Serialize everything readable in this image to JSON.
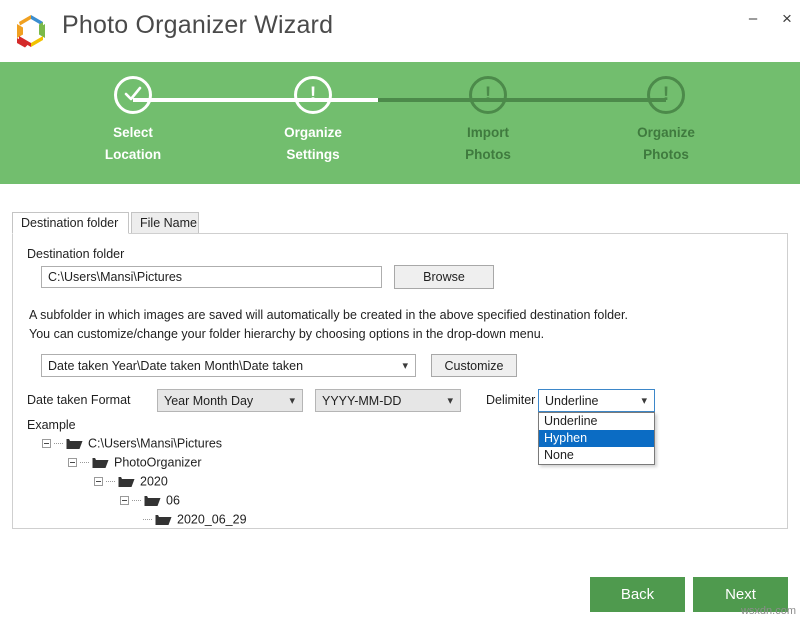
{
  "window": {
    "title": "Photo Organizer Wizard",
    "logo_icon": "hexagon-pinwheel-logo",
    "minimize_label": "–",
    "close_label": "×"
  },
  "stepper": {
    "accent_color": "#72be6e",
    "inactive_color": "#4c8a4a",
    "steps": [
      {
        "line1": "Select",
        "line2": "Location",
        "glyph": "✓",
        "state": "done",
        "icon": "check-icon"
      },
      {
        "line1": "Organize",
        "line2": "Settings",
        "glyph": "!",
        "state": "current",
        "icon": "exclamation-icon"
      },
      {
        "line1": "Import",
        "line2": "Photos",
        "glyph": "!",
        "state": "inactive",
        "icon": "exclamation-icon"
      },
      {
        "line1": "Organize",
        "line2": "Photos",
        "glyph": "!",
        "state": "inactive",
        "icon": "exclamation-icon"
      }
    ]
  },
  "tabs": [
    {
      "label": "Destination folder",
      "active": true
    },
    {
      "label": "File Name",
      "active": false
    }
  ],
  "form": {
    "destination_label": "Destination folder",
    "destination_value": "C:\\Users\\Mansi\\Pictures",
    "destination_placeholder": "Destination folder path",
    "browse_label": "Browse",
    "description": "A subfolder in which images are saved will automatically be created in the above specified destination folder.\nYou can customize/change your folder hierarchy by choosing options in the drop-down menu.",
    "hierarchy_value": "Date taken Year\\Date taken Month\\Date taken",
    "customize_label": "Customize",
    "date_format_label": "Date taken Format",
    "date_order_value": "Year Month Day",
    "date_pattern_value": "YYYY-MM-DD",
    "delimiter_label": "Delimiter",
    "delimiter_value": "Underline",
    "delimiter_options": [
      {
        "label": "Underline",
        "selected": false
      },
      {
        "label": "Hyphen",
        "selected": true
      },
      {
        "label": "None",
        "selected": false
      }
    ],
    "dropdown_highlight_color": "#0b6cc4"
  },
  "example": {
    "label": "Example",
    "nodes": [
      {
        "label": "C:\\Users\\Mansi\\Pictures",
        "depth": 0,
        "expander": true,
        "icon": "folder-icon"
      },
      {
        "label": "PhotoOrganizer",
        "depth": 1,
        "expander": true,
        "icon": "folder-icon"
      },
      {
        "label": "2020",
        "depth": 2,
        "expander": true,
        "icon": "folder-icon"
      },
      {
        "label": "06",
        "depth": 3,
        "expander": true,
        "icon": "folder-icon"
      },
      {
        "label": "2020_06_29",
        "depth": 4,
        "expander": false,
        "icon": "folder-icon"
      }
    ]
  },
  "footer": {
    "back_label": "Back",
    "next_label": "Next",
    "button_color": "#4f9a4e",
    "watermark": "wsxdn.com"
  }
}
